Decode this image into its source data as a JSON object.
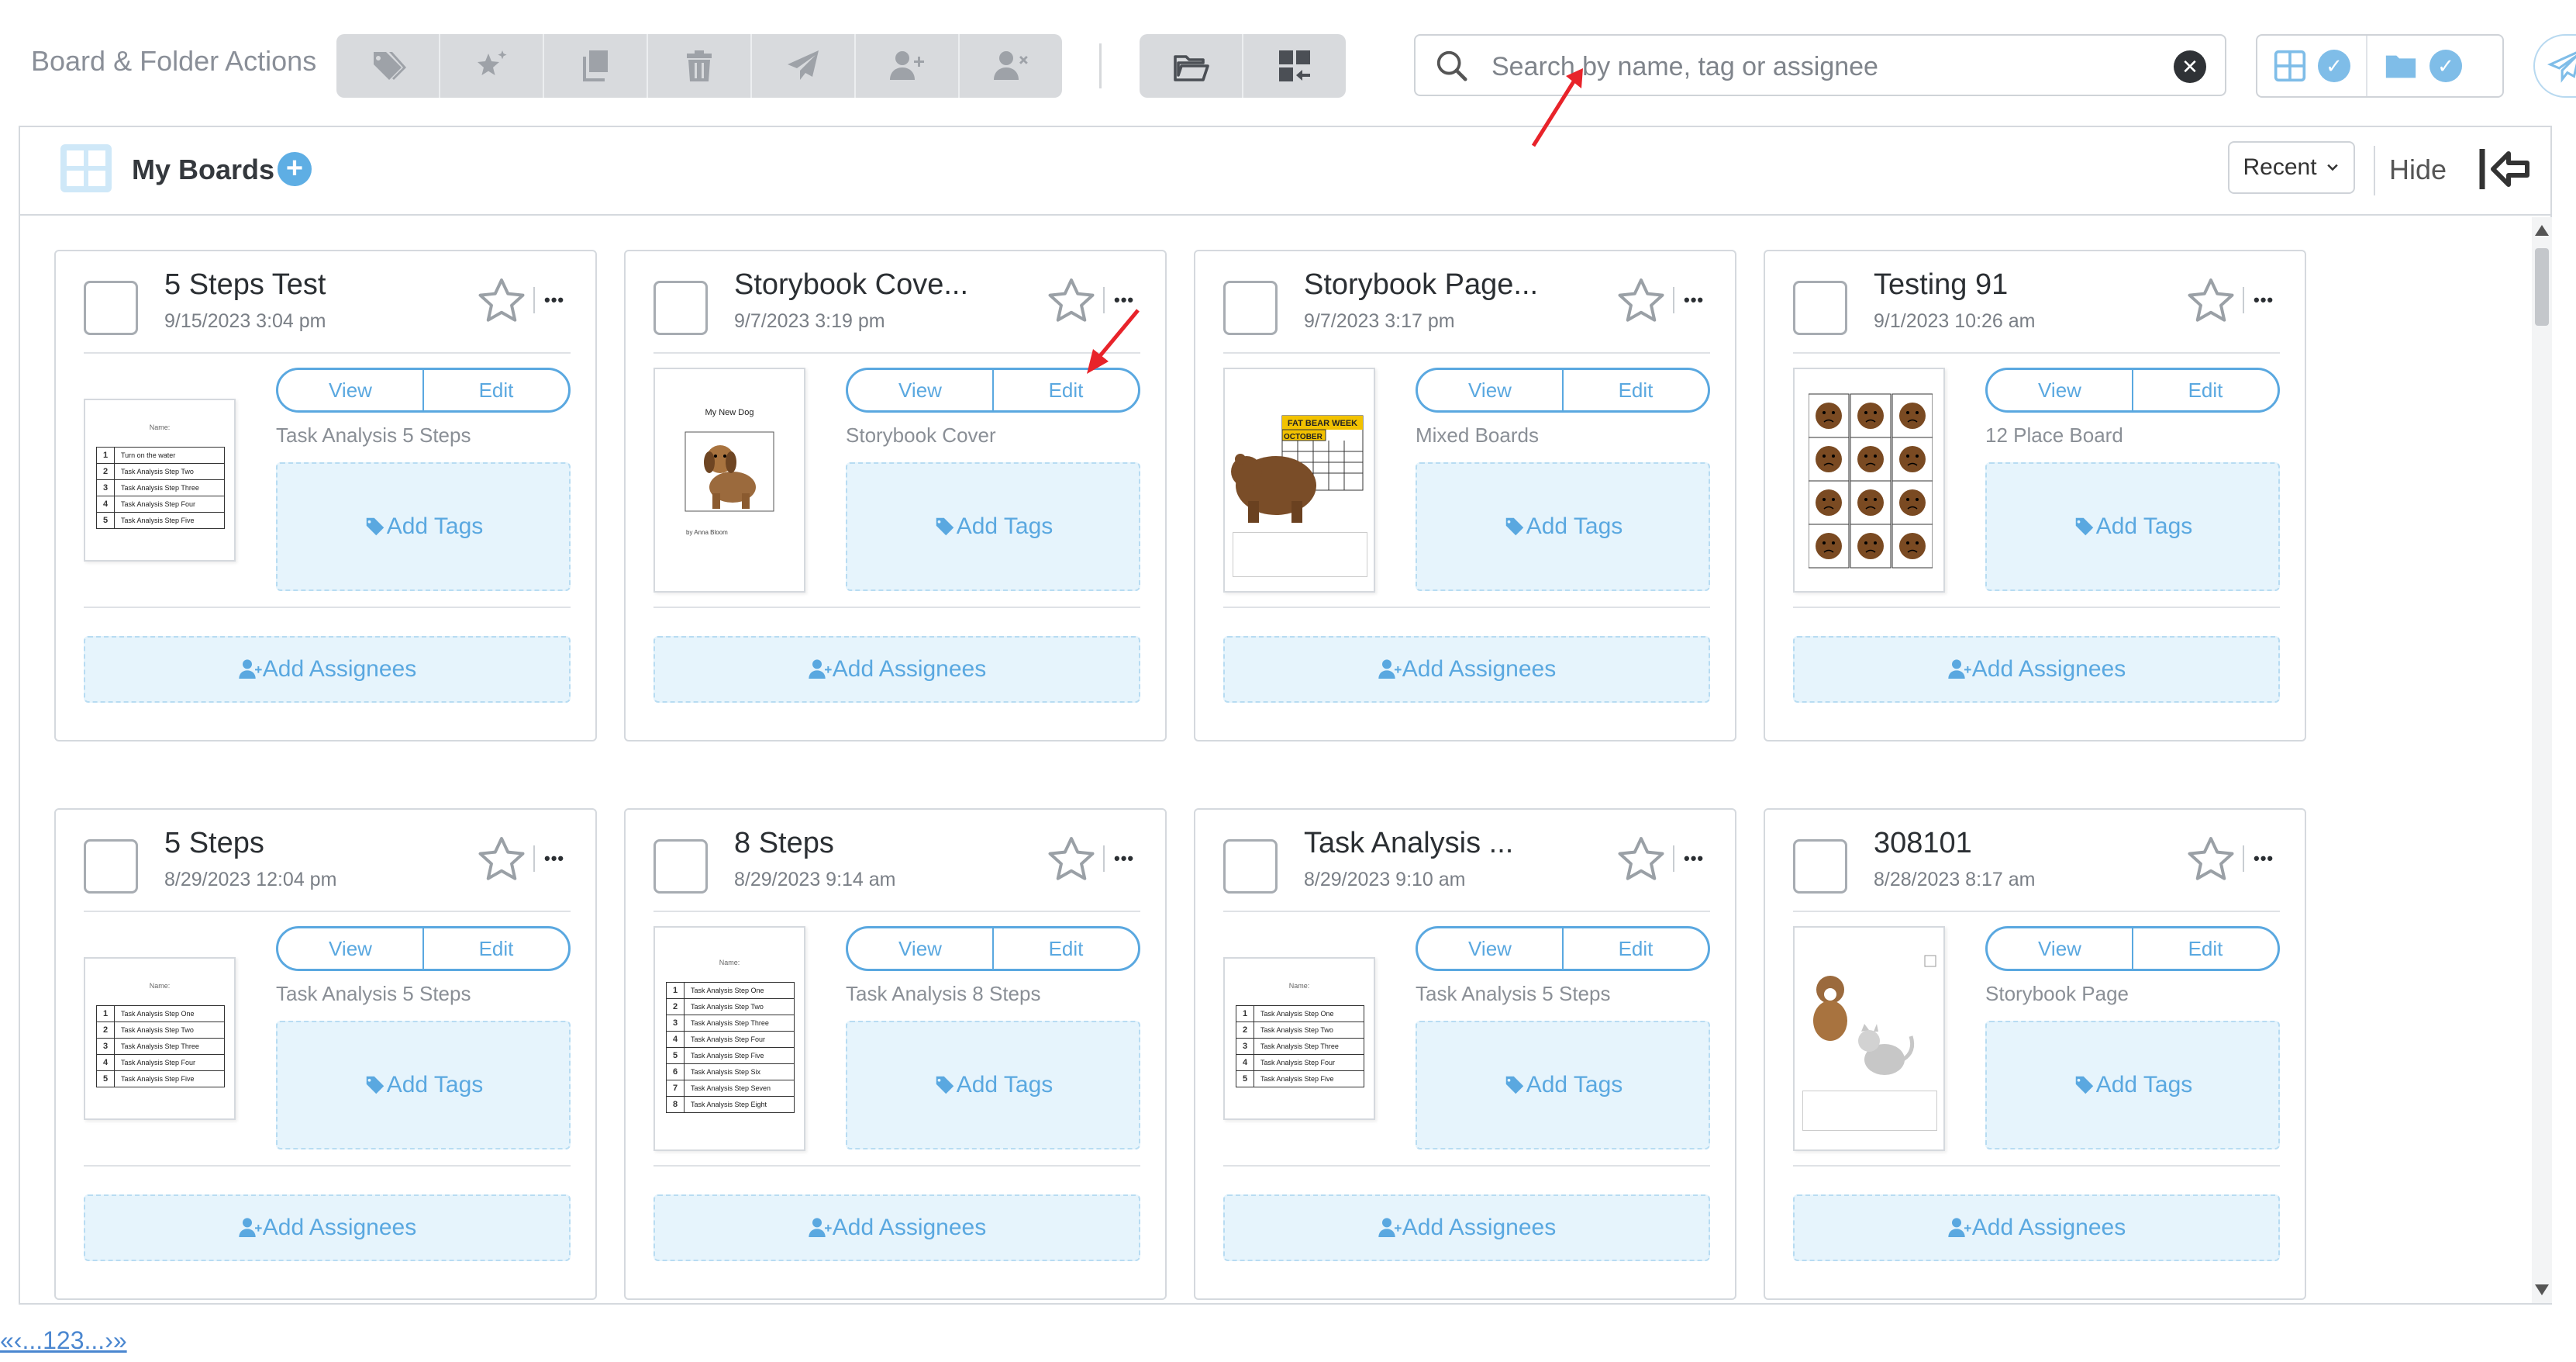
{
  "toolbar": {
    "title": "Board & Folder Actions",
    "group1_icons": [
      "tag-icon",
      "magic-star-icon",
      "copy-icon",
      "trash-icon",
      "send-icon",
      "add-user-icon",
      "remove-user-icon"
    ],
    "group2_icons": [
      "move-to-folder-icon",
      "boards-move-icon"
    ]
  },
  "search": {
    "placeholder": "Search by name, tag or assignee",
    "value": ""
  },
  "view_toggle": {
    "boards_icon": "grid-icon",
    "folders_icon": "folder-icon"
  },
  "panel": {
    "title": "My Boards",
    "sort_label": "Recent",
    "hide_label": "Hide"
  },
  "card_labels": {
    "view": "View",
    "edit": "Edit",
    "add_tags": "Add Tags",
    "add_assignees": "Add Assignees"
  },
  "boards": [
    {
      "title": "5 Steps Test",
      "date": "9/15/2023 3:04 pm",
      "type": "Task Analysis 5 Steps",
      "thumb": "table5"
    },
    {
      "title": "Storybook Cove...",
      "date": "9/7/2023 3:19 pm",
      "type": "Storybook Cover",
      "thumb": "dog",
      "thumb_title": "My New Dog",
      "thumb_author": "by Anna Bloom"
    },
    {
      "title": "Storybook Page...",
      "date": "9/7/2023 3:17 pm",
      "type": "Mixed Boards",
      "thumb": "bear",
      "thumb_title": "FAT BEAR WEEK",
      "thumb_month": "OCTOBER"
    },
    {
      "title": "Testing 91",
      "date": "9/1/2023 10:26 am",
      "type": "12 Place Board",
      "thumb": "faces"
    },
    {
      "title": "5 Steps",
      "date": "8/29/2023 12:04 pm",
      "type": "Task Analysis 5 Steps",
      "thumb": "table5"
    },
    {
      "title": "8 Steps",
      "date": "8/29/2023 9:14 am",
      "type": "Task Analysis 8 Steps",
      "thumb": "table8"
    },
    {
      "title": "Task Analysis ...",
      "date": "8/29/2023 9:10 am",
      "type": "Task Analysis 5 Steps",
      "thumb": "table5"
    },
    {
      "title": "308101",
      "date": "8/28/2023 8:17 am",
      "type": "Storybook Page",
      "thumb": "animals"
    }
  ],
  "thumb_rows": {
    "first": [
      "Turn on the water",
      "Task Analysis Step Two",
      "Task Analysis Step Three",
      "Task Analysis Step Four",
      "Task Analysis Step Five"
    ],
    "five": [
      "Task Analysis Step One",
      "Task Analysis Step Two",
      "Task Analysis Step Three",
      "Task Analysis Step Four",
      "Task Analysis Step Five"
    ],
    "eight": [
      "Task Analysis Step One",
      "Task Analysis Step Two",
      "Task Analysis Step Three",
      "Task Analysis Step Four",
      "Task Analysis Step Five",
      "Task Analysis Step Six",
      "Task Analysis Step Seven",
      "Task Analysis Step Eight"
    ]
  },
  "thumb_name_label": "Name:",
  "pagination": "«‹...123...›»",
  "colors": {
    "accent": "#5aa8e0",
    "tag_bg": "#e6f4fc",
    "annotation_arrow": "#e8232a"
  }
}
